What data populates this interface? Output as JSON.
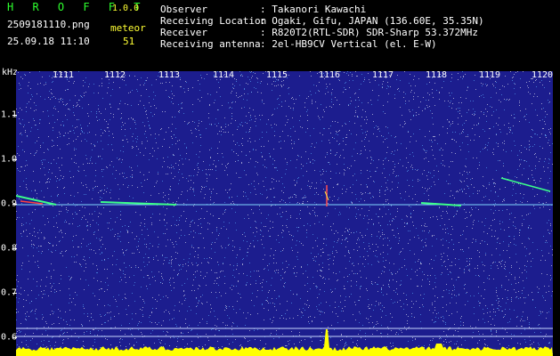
{
  "app": {
    "title": "H R O F F T",
    "version": "1.0.0"
  },
  "file_name": "2509181110.png",
  "date_time": "25.09.18 11:10",
  "meteor": {
    "label": "meteor",
    "count": "51"
  },
  "station_info": [
    {
      "key": "Observer",
      "value": ": Takanori Kawachi"
    },
    {
      "key": "Receiving Location",
      "value": ": Ogaki, Gifu, JAPAN (136.60E, 35.35N)"
    },
    {
      "key": "Receiver",
      "value": ": R820T2(RTL-SDR) SDR-Sharp 53.372MHz"
    },
    {
      "key": "Receiving antenna",
      "value": ": 2el-HB9CV Vertical (el. E-W)"
    }
  ],
  "colors": {
    "background": "#1c1d8e",
    "header_green": "#2eff2e",
    "header_yellow": "#ffff33",
    "noise": "#ffffff",
    "baseline": "#ffff00"
  },
  "spectrogram": {
    "y_unit": "kHz",
    "y_ticks": [
      "1.1",
      "1.0",
      "0.9",
      "0.8",
      "0.7",
      "0.6"
    ],
    "minute_labels": [
      "1111",
      "1112",
      "1113",
      "1114",
      "1115",
      "1116",
      "1117",
      "1118",
      "1119",
      "1120"
    ]
  }
}
